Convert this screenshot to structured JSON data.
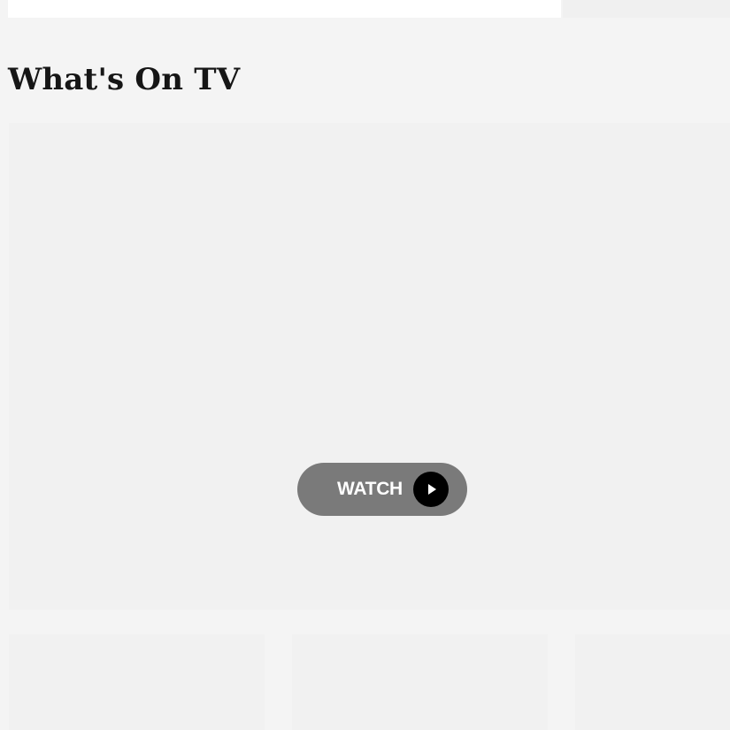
{
  "section": {
    "title": "What's On TV"
  },
  "hero": {
    "watch_label": "WATCH",
    "play_icon": "play-icon"
  },
  "cards": [
    {
      "name": "card-1"
    },
    {
      "name": "card-2"
    },
    {
      "name": "card-3"
    }
  ],
  "colors": {
    "page_background": "#f4f4f4",
    "placeholder": "#f1f1f1",
    "watch_button": "#7a7a7a",
    "play_circle": "#000000",
    "title_text": "#161616"
  }
}
